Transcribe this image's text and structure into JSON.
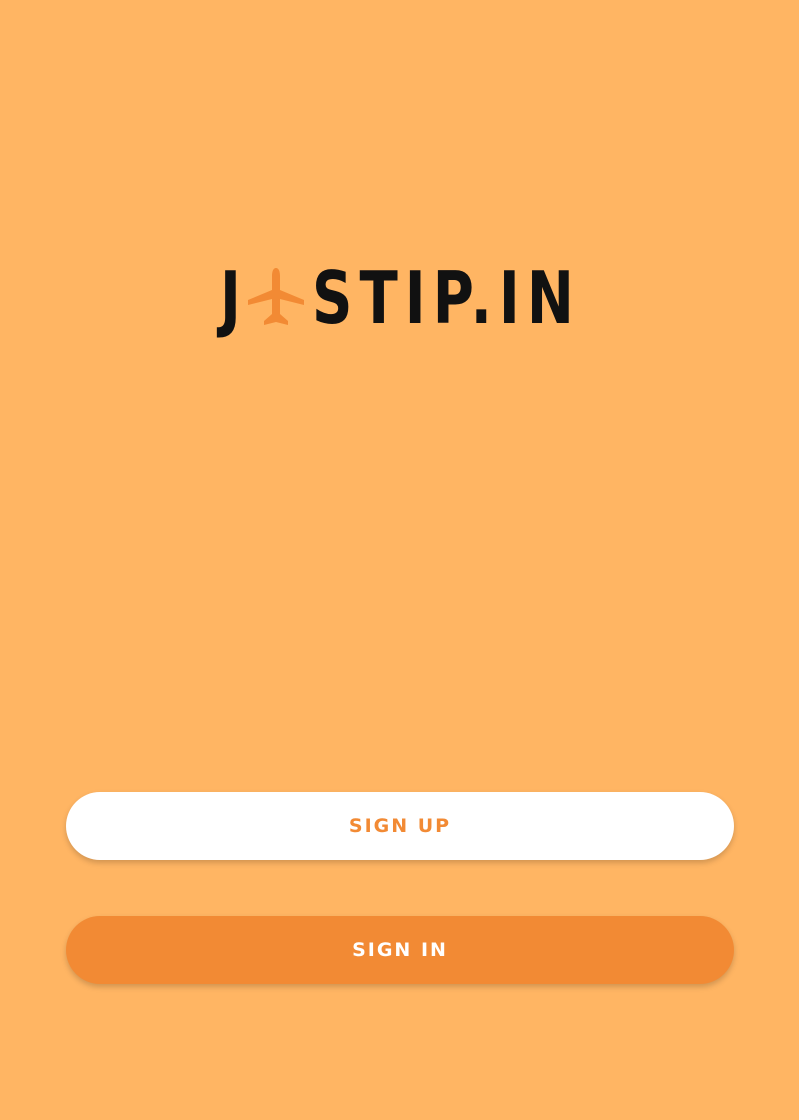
{
  "colors": {
    "background": "#FFB563",
    "accent": "#F28A34",
    "logo_text": "#111111",
    "button_light": "#FFFFFF"
  },
  "logo": {
    "text_before_icon": "J",
    "icon": "airplane-icon",
    "text_after_icon": "STIP.IN"
  },
  "buttons": {
    "sign_up_label": "SIGN UP",
    "sign_in_label": "SIGN IN"
  }
}
